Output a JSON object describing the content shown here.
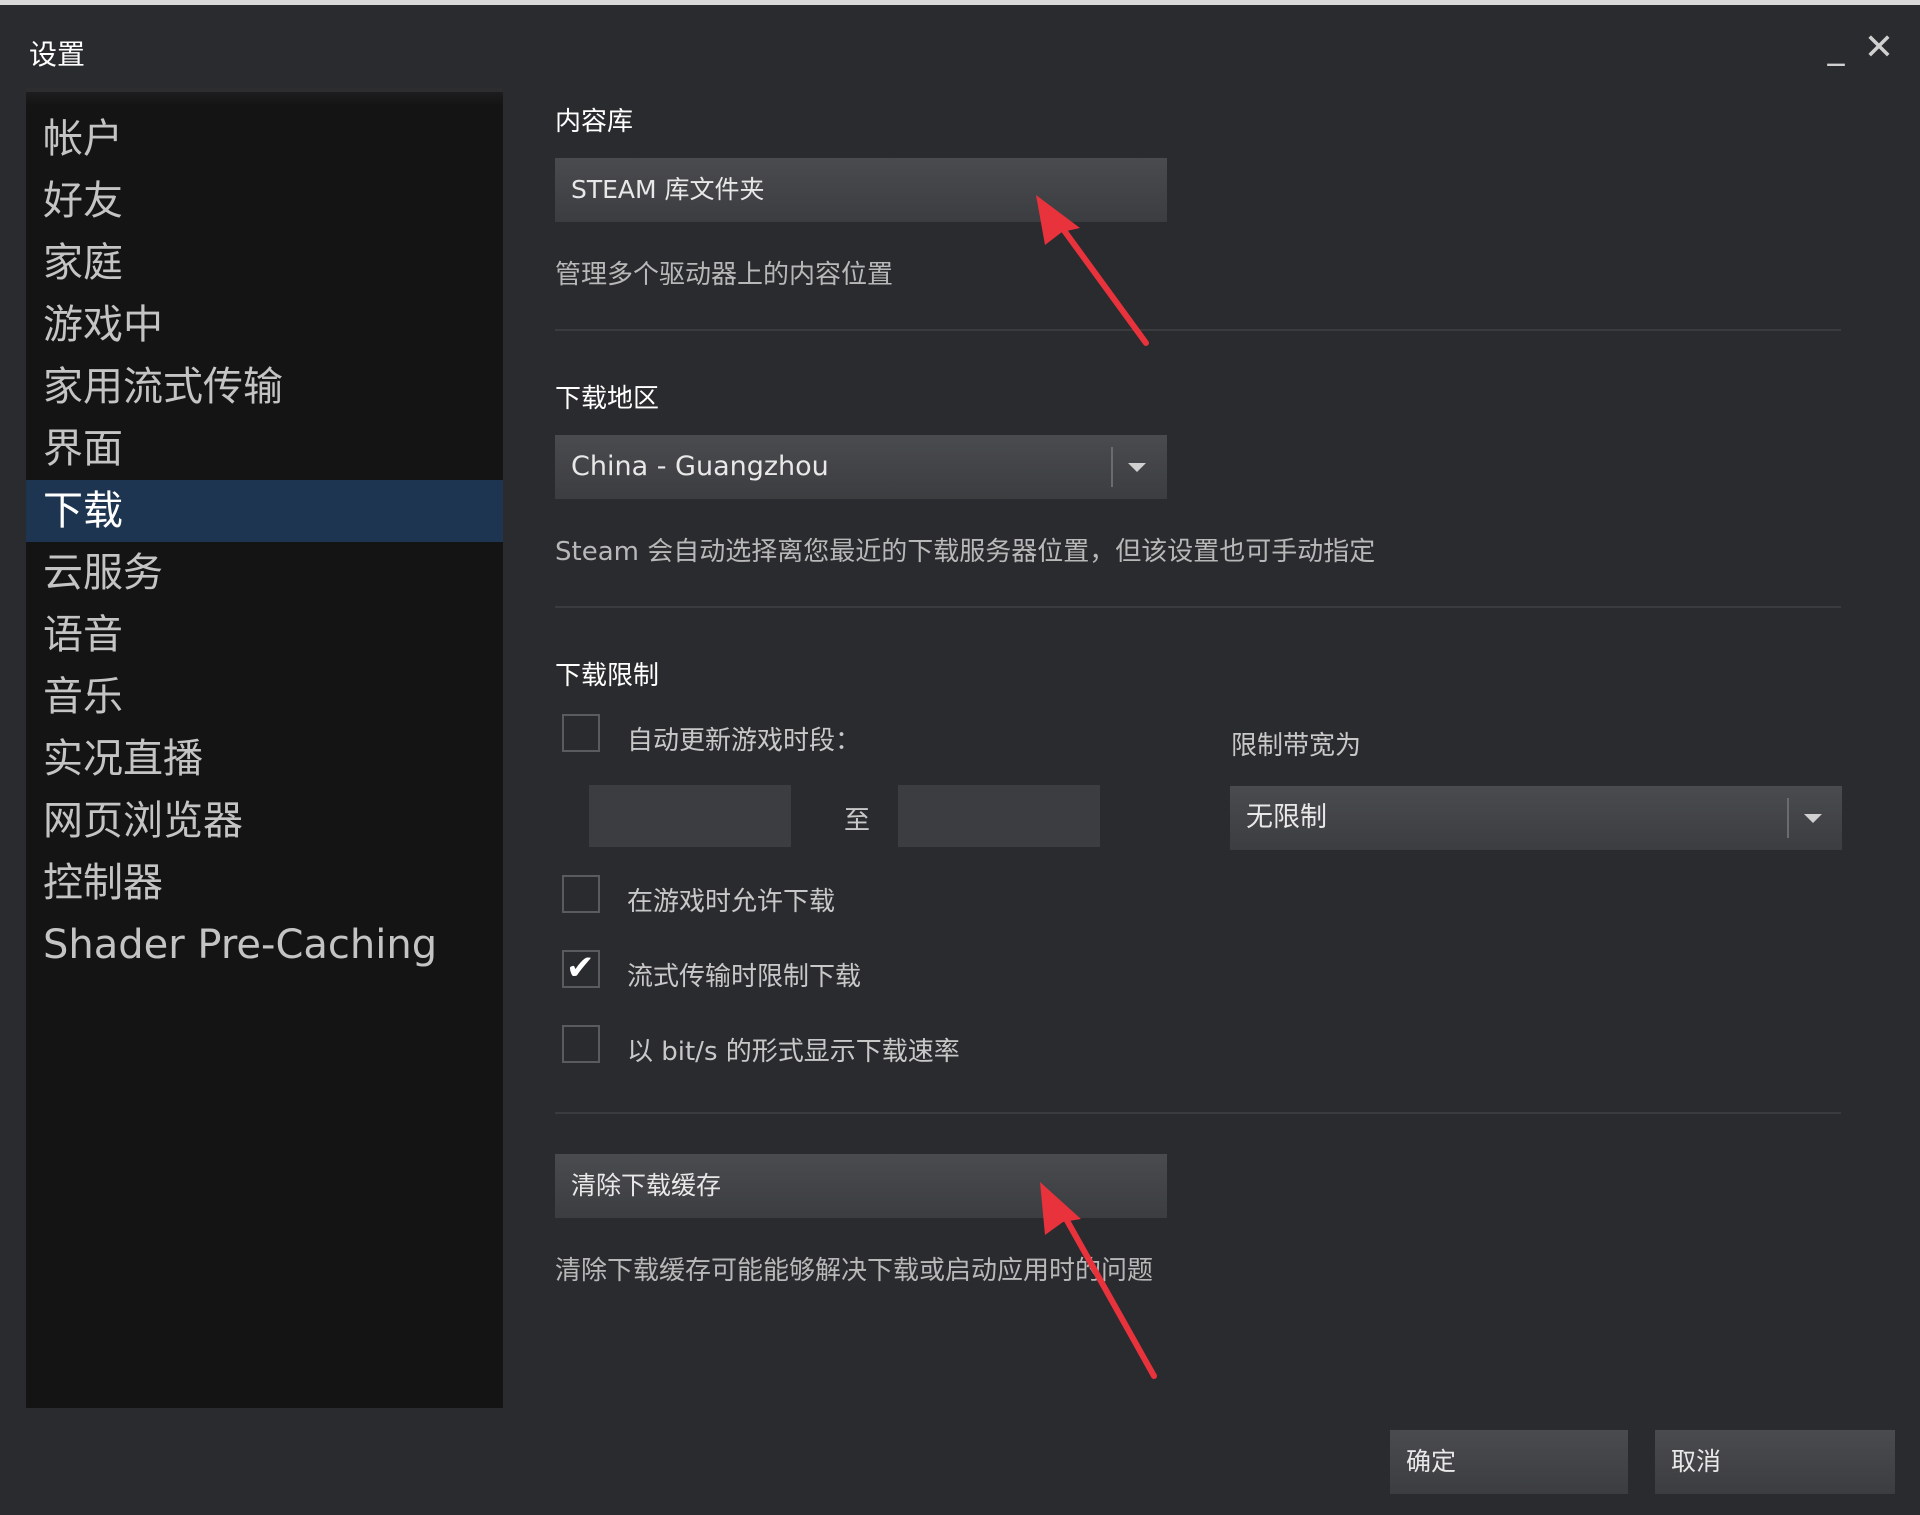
{
  "window": {
    "title": "设置",
    "minimize_glyph": "_",
    "close_glyph": "✕"
  },
  "sidebar": {
    "items": [
      {
        "label": "帐户",
        "active": false
      },
      {
        "label": "好友",
        "active": false
      },
      {
        "label": "家庭",
        "active": false
      },
      {
        "label": "游戏中",
        "active": false
      },
      {
        "label": "家用流式传输",
        "active": false
      },
      {
        "label": "界面",
        "active": false
      },
      {
        "label": "下载",
        "active": true
      },
      {
        "label": "云服务",
        "active": false
      },
      {
        "label": "语音",
        "active": false
      },
      {
        "label": "音乐",
        "active": false
      },
      {
        "label": "实况直播",
        "active": false
      },
      {
        "label": "网页浏览器",
        "active": false
      },
      {
        "label": "控制器",
        "active": false
      },
      {
        "label": "Shader Pre-Caching",
        "active": false
      }
    ]
  },
  "content_library": {
    "title": "内容库",
    "button_label": "STEAM 库文件夹",
    "description": "管理多个驱动器上的内容位置"
  },
  "download_region": {
    "title": "下载地区",
    "selected": "China - Guangzhou",
    "description": "Steam 会自动选择离您最近的下载服务器位置，但该设置也可手动指定"
  },
  "download_limits": {
    "title": "下载限制",
    "auto_update_label": "自动更新游戏时段：",
    "auto_update_checked": false,
    "time_separator": "至",
    "start_time": "",
    "end_time": "",
    "bandwidth_label": "限制带宽为",
    "bandwidth_selected": "无限制",
    "allow_while_playing_label": "在游戏时允许下载",
    "allow_while_playing_checked": false,
    "throttle_streaming_label": "流式传输时限制下载",
    "throttle_streaming_checked": true,
    "bits_display_label": "以 bit/s 的形式显示下载速率",
    "bits_display_checked": false
  },
  "cache": {
    "button_label": "清除下载缓存",
    "description": "清除下载缓存可能能够解决下载或启动应用时的问题"
  },
  "footer": {
    "ok_label": "确定",
    "cancel_label": "取消"
  },
  "colors": {
    "accent_active": "#1d3551",
    "annotation_arrow": "#e8323c"
  }
}
